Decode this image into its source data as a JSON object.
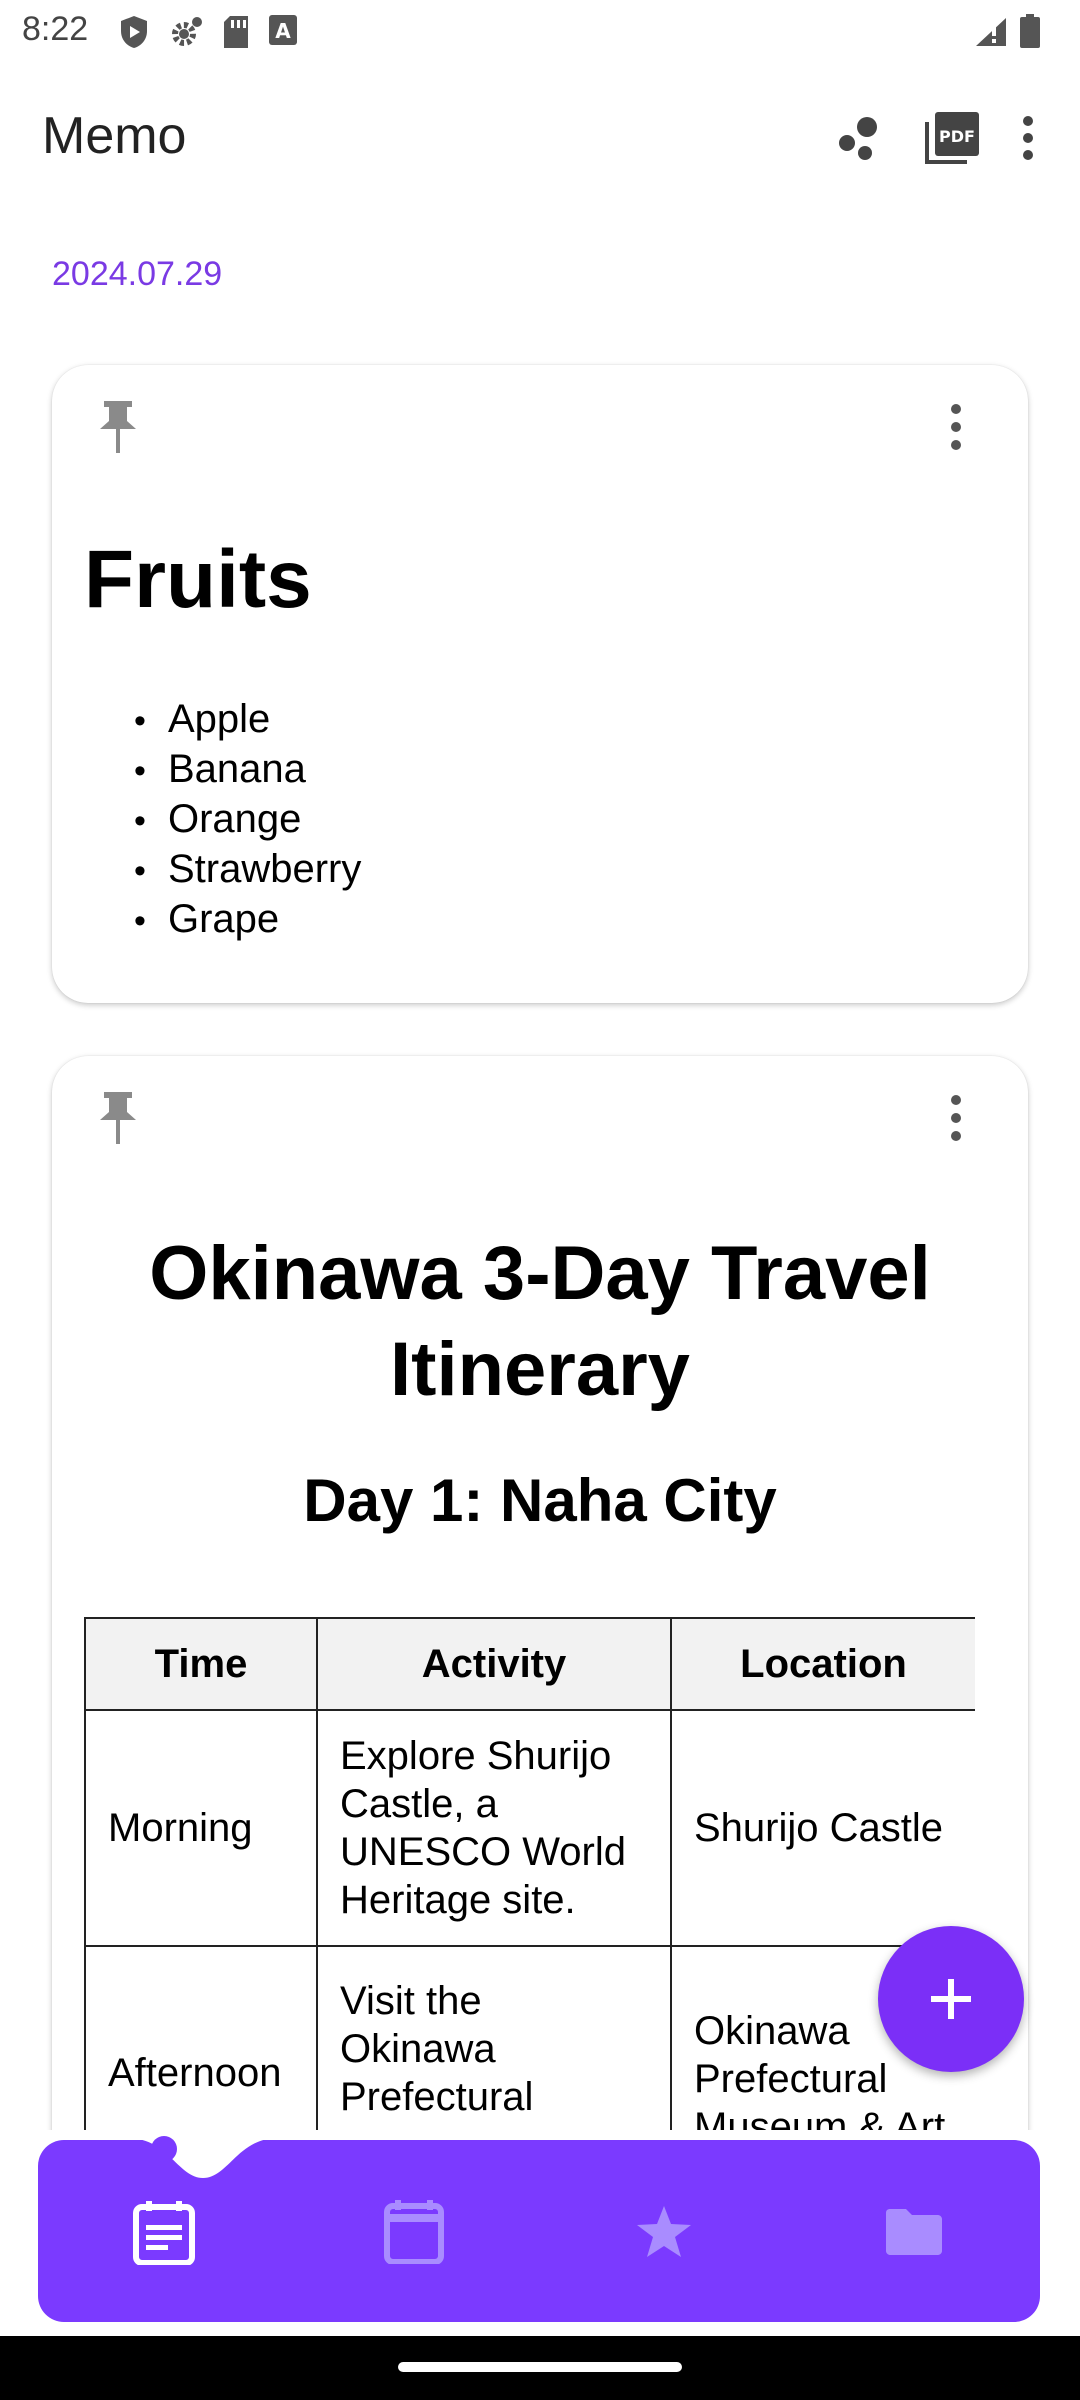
{
  "status_bar": {
    "time": "8:22",
    "icons": [
      "shield-icon",
      "gear-icon",
      "sd-card-icon",
      "font-icon",
      "signal-icon",
      "battery-icon"
    ]
  },
  "app_bar": {
    "title": "Memo",
    "actions": [
      "share-dots-icon",
      "pdf-icon",
      "more-vert-icon"
    ],
    "pdf_label": "PDF"
  },
  "date": "2024.07.29",
  "memos": [
    {
      "title": "Fruits",
      "items": [
        "Apple",
        "Banana",
        "Orange",
        "Strawberry",
        "Grape"
      ]
    },
    {
      "title_line1": "Okinawa 3-Day Travel",
      "title_line2": "Itinerary",
      "day_title": "Day 1: Naha City",
      "table": {
        "headers": [
          "Time",
          "Activity",
          "Location"
        ],
        "rows": [
          [
            "Morning",
            "Explore Shurijo Castle, a UNESCO World Heritage site.",
            "Shurijo Castle"
          ],
          [
            "Afternoon",
            "Visit the Okinawa Prefectural Museum & Art",
            "Okinawa Prefectural Museum & Art M..."
          ]
        ]
      }
    }
  ],
  "fab": {
    "icon": "plus-icon"
  },
  "bottom_nav": {
    "items": [
      "memo-icon",
      "calendar-icon",
      "star-icon",
      "folder-icon"
    ],
    "selected": 0
  },
  "colors": {
    "accent": "#7b3aff",
    "fab": "#7b2ff7",
    "date_text": "#7a3ae4",
    "pin": "#8a8a8a"
  }
}
